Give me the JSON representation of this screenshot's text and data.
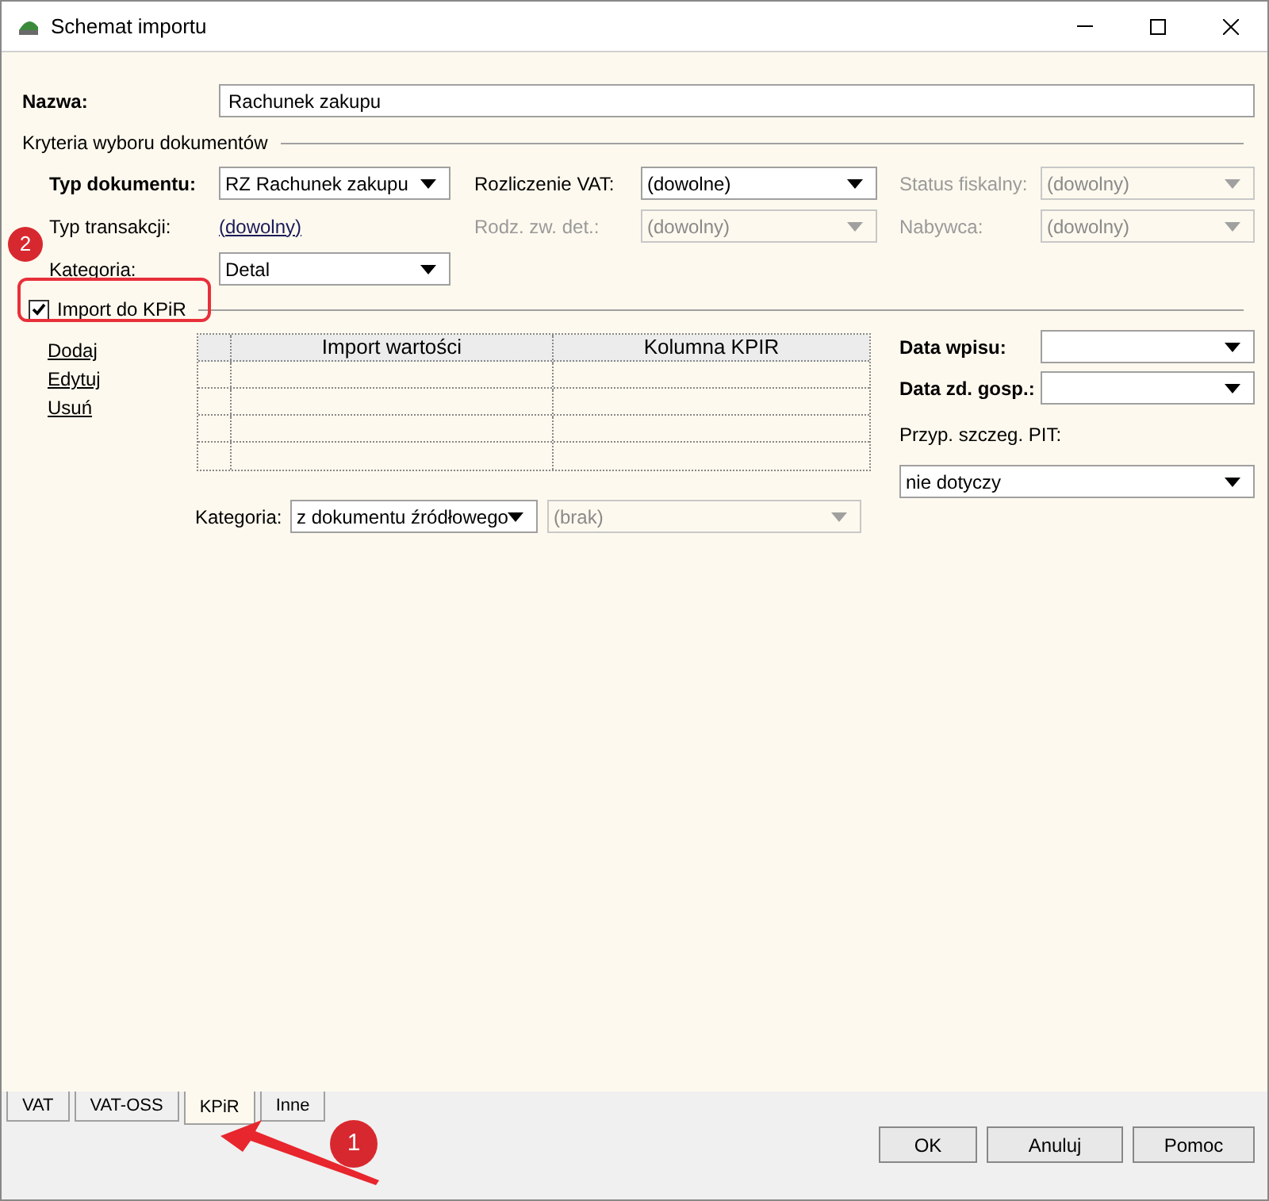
{
  "window": {
    "title": "Schemat importu"
  },
  "name_field": {
    "label": "Nazwa:",
    "value": "Rachunek zakupu"
  },
  "criteria": {
    "title": "Kryteria wyboru dokumentów",
    "rows": [
      [
        {
          "label": "Typ dokumentu:",
          "bold": true,
          "kind": "dropdown",
          "value": "RZ Rachunek zakupu",
          "disabled": false
        },
        {
          "label": "Rozliczenie VAT:",
          "bold": false,
          "kind": "dropdown",
          "value": "(dowolne)",
          "disabled": false
        },
        {
          "label": "Status fiskalny:",
          "bold": false,
          "kind": "dropdown",
          "value": "(dowolny)",
          "disabled": true
        }
      ],
      [
        {
          "label": "Typ transakcji:",
          "bold": false,
          "kind": "link",
          "value": "(dowolny)",
          "disabled": false
        },
        {
          "label": "Rodz. zw. det.:",
          "bold": false,
          "kind": "dropdown",
          "value": "(dowolny)",
          "disabled": true
        },
        {
          "label": "Nabywca:",
          "bold": false,
          "kind": "dropdown",
          "value": "(dowolny)",
          "disabled": true
        }
      ],
      [
        {
          "label": "Kategoria:",
          "bold": false,
          "kind": "dropdown",
          "value": "Detal",
          "disabled": false
        }
      ]
    ]
  },
  "import_checkbox": {
    "label": "Import do KPiR",
    "checked": true
  },
  "actions": [
    "Dodaj",
    "Edytuj",
    "Usuń"
  ],
  "table": {
    "columns": [
      "Import wartości",
      "Kolumna KPIR"
    ]
  },
  "right_fields": [
    {
      "label": "Data wpisu:",
      "bold": true
    },
    {
      "label": "Data zd. gosp.:",
      "bold": true
    }
  ],
  "pit": {
    "label": "Przyp. szczeg. PIT:",
    "value": "nie dotyczy"
  },
  "category": {
    "label": "Kategoria:",
    "value": "z dokumentu źródłowego",
    "second_value": "(brak)",
    "second_disabled": true
  },
  "tabs": [
    {
      "label": "VAT",
      "selected": false
    },
    {
      "label": "VAT-OSS",
      "selected": false
    },
    {
      "label": "KPiR",
      "selected": true
    },
    {
      "label": "Inne",
      "selected": false
    }
  ],
  "buttons": [
    "OK",
    "Anuluj",
    "Pomoc"
  ],
  "annotations": [
    {
      "number": "1",
      "kind": "arrow"
    },
    {
      "number": "2",
      "kind": "frame"
    }
  ]
}
